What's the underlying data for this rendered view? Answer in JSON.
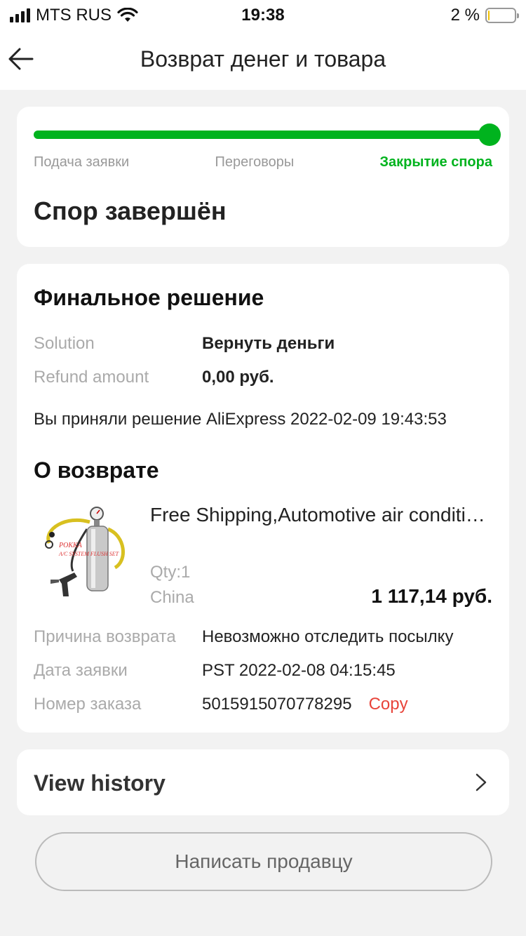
{
  "status_bar": {
    "carrier": "MTS RUS",
    "time": "19:38",
    "battery_text": "2 %",
    "battery_level": 0.02
  },
  "header": {
    "title": "Возврат денег и товара"
  },
  "progress": {
    "steps": [
      "Подача заявки",
      "Переговоры",
      "Закрытие спора"
    ],
    "active_step": 2,
    "fraction": 1.0,
    "accent_color": "#00b31e"
  },
  "dispute": {
    "status": "Спор завершён"
  },
  "final_decision": {
    "heading": "Финальное решение",
    "solution_label": "Solution",
    "solution_value": "Вернуть деньги",
    "refund_label": "Refund amount",
    "refund_value": "0,00 руб.",
    "note": "Вы приняли решение AliExpress 2022-02-09 19:43:53"
  },
  "return_info": {
    "heading": "О возврате",
    "product": {
      "title": "Free Shipping,Automotive air conditioning A/C system flush set",
      "image_caption_line1": "POKKA",
      "image_caption_line2": "A/C SYSTEM FLUSH SET",
      "qty": "Qty:1",
      "origin": "China",
      "price": "1 117,14 руб."
    },
    "reason_label": "Причина возврата",
    "reason_value": "Невозможно отследить посылку",
    "date_label": "Дата заявки",
    "date_value": "PST 2022-02-08 04:15:45",
    "order_label": "Номер заказа",
    "order_value": "5015915070778295",
    "copy_label": "Copy"
  },
  "history": {
    "label": "View history"
  },
  "contact": {
    "label": "Написать продавцу"
  },
  "icons": {
    "back": "arrow-left-icon",
    "history": "chevron-right-icon",
    "signal": "cellular-signal-icon",
    "wifi": "wifi-icon",
    "battery": "battery-icon"
  }
}
